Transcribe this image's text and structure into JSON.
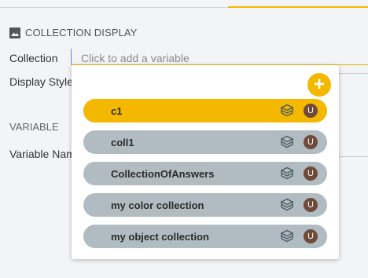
{
  "section": {
    "title": "COLLECTION DISPLAY",
    "icon": "image-icon"
  },
  "fields": {
    "collection_label": "Collection",
    "collection_placeholder": "Click to add a variable",
    "display_style_label": "Display Style",
    "variable_heading": "VARIABLE",
    "variable_name_label": "Variable Nam"
  },
  "popup": {
    "add_label": "+",
    "items": [
      {
        "name": "c1",
        "badge": "U",
        "selected": true
      },
      {
        "name": "coll1",
        "badge": "U",
        "selected": false
      },
      {
        "name": "CollectionOfAnswers",
        "badge": "U",
        "selected": false
      },
      {
        "name": "my color collection",
        "badge": "U",
        "selected": false
      },
      {
        "name": "my object collection",
        "badge": "U",
        "selected": false
      }
    ]
  },
  "colors": {
    "accent": "#f5b800",
    "item_bg": "#b0bcc2",
    "badge_bg": "#6d4a3a",
    "focus": "#4a90d9"
  }
}
